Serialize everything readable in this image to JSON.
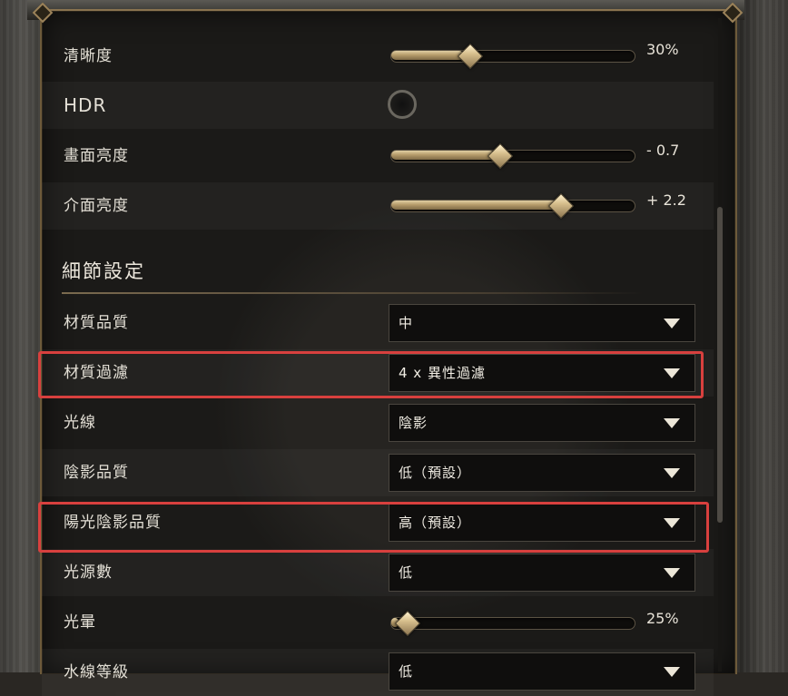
{
  "settings": [
    {
      "id": "clarity",
      "label": "清晰度",
      "type": "slider",
      "value_text": "30%",
      "fraction": 0.3
    },
    {
      "id": "hdr",
      "label": "HDR",
      "type": "checkbox",
      "checked": false
    },
    {
      "id": "screen-brightness",
      "label": "畫面亮度",
      "type": "slider",
      "value_text": "- 0.7",
      "fraction": 0.43
    },
    {
      "id": "ui-brightness",
      "label": "介面亮度",
      "type": "slider",
      "value_text": "+ 2.2",
      "fraction": 0.69
    }
  ],
  "section": {
    "title": "細節設定"
  },
  "details": [
    {
      "id": "texture-quality",
      "label": "材質品質",
      "value": "中",
      "highlighted": false
    },
    {
      "id": "texture-filtering",
      "label": "材質過濾",
      "value": "4 x 異性過濾",
      "highlighted": true
    },
    {
      "id": "lighting",
      "label": "光線",
      "value": "陰影",
      "highlighted": false
    },
    {
      "id": "shadow-quality",
      "label": "陰影品質",
      "value": "低（預設）",
      "highlighted": false
    },
    {
      "id": "sun-shadow-quality",
      "label": "陽光陰影品質",
      "value": "高（預設）",
      "highlighted": true
    },
    {
      "id": "light-count",
      "label": "光源數",
      "value": "低",
      "highlighted": false
    }
  ],
  "bloom": {
    "label": "光暈",
    "value_text": "25%",
    "fraction": 0.03
  },
  "water": {
    "label": "水線等級",
    "value": "低"
  },
  "colors": {
    "highlight": "#d8403e",
    "accent_gold": "#d6be8c"
  }
}
